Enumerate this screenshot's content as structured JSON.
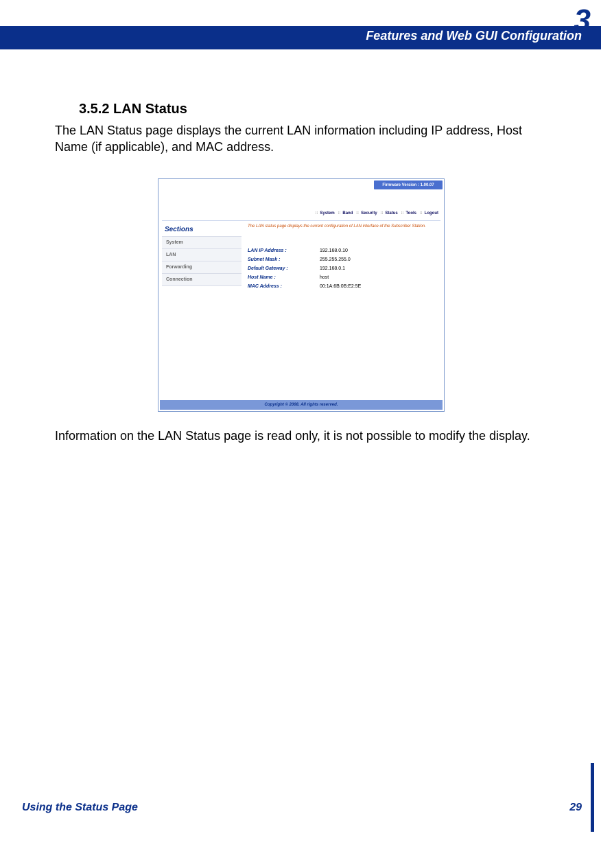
{
  "chapter_number": "3",
  "header_title": "Features and Web GUI Configuration",
  "section_heading": "3.5.2 LAN Status",
  "para1": "The LAN Status page displays the current LAN information including IP address, Host Name (if applicable), and MAC address.",
  "para2": "Information on the LAN Status page is read only, it is not possible to modify the display.",
  "screenshot": {
    "firmware_label": "Firmware Version : 1.00.07",
    "topnav": {
      "system": "System",
      "band": "Band",
      "security": "Security",
      "status": "Status",
      "tools": "Tools",
      "logout": "Logout"
    },
    "sidebar": {
      "title": "Sections",
      "items": {
        "system": "System",
        "lan": "LAN",
        "forwarding": "Forwarding",
        "connection": "Connection"
      }
    },
    "description": "The LAN status page displays the current configuration of LAN interface of the Subscriber Station.",
    "fields": {
      "lan_ip": {
        "label": "LAN IP Address :",
        "value": "192.168.0.10"
      },
      "subnet": {
        "label": "Subnet Mask :",
        "value": "255.255.255.0"
      },
      "gateway": {
        "label": "Default Gateway :",
        "value": "192.168.0.1"
      },
      "hostname": {
        "label": "Host Name :",
        "value": "host"
      },
      "mac": {
        "label": "MAC Address :",
        "value": "00:1A:6B:0B:E2:5E"
      }
    },
    "footer": "Copyright © 2008.  All rights reserved."
  },
  "footer_title": "Using the Status Page",
  "page_number": "29"
}
